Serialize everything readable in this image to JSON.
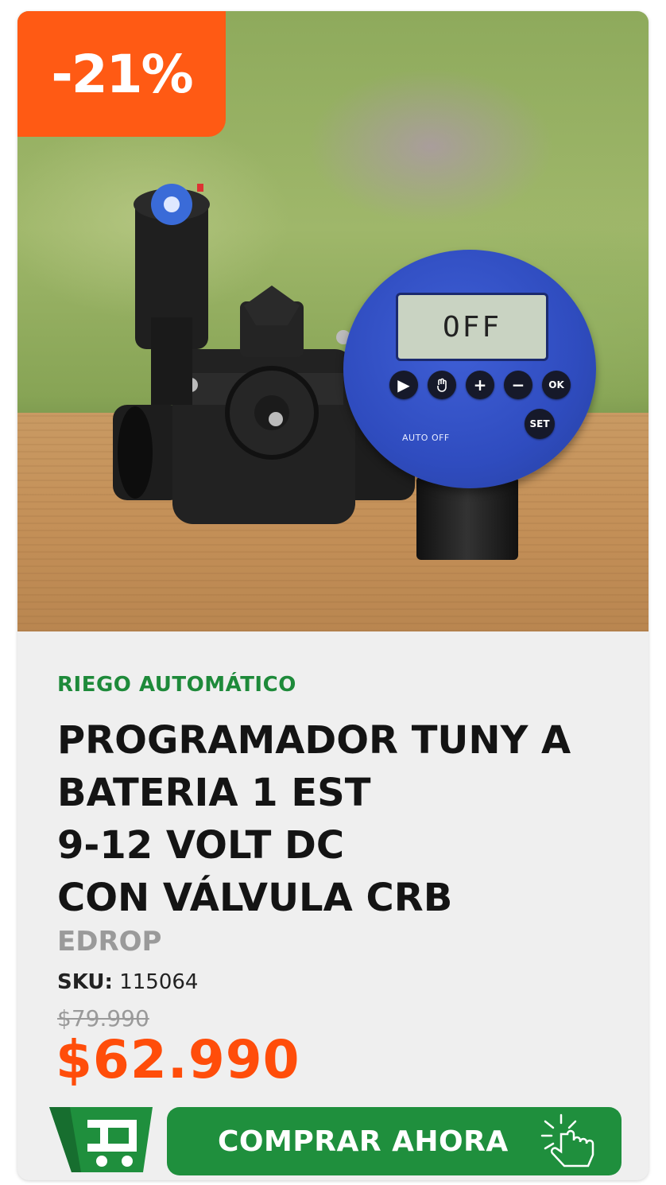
{
  "badge": {
    "discount": "-21%"
  },
  "product_image": {
    "lcd_text": "OFF",
    "controller_buttons": [
      "▶",
      "+",
      "−",
      "OK",
      "SET"
    ],
    "controller_labels": "AUTO  OFF"
  },
  "product": {
    "category": "RIEGO AUTOMÁTICO",
    "title_lines": [
      "PROGRAMADOR TUNY A",
      "BATERIA 1 EST",
      "9-12 VOLT DC",
      "CON VÁLVULA CRB"
    ],
    "brand": "EDROP",
    "sku_label": "SKU:",
    "sku_value": "115064",
    "old_price": "$79.990",
    "price": "$62.990"
  },
  "actions": {
    "cart_icon": "cart-icon",
    "buy_label": "COMPRAR AHORA",
    "buy_icon": "hand-pointer-icon"
  },
  "colors": {
    "accent_orange": "#ff5a14",
    "price_orange": "#ff4d0a",
    "green": "#1f8f3d",
    "category_green": "#1e8a3a"
  }
}
